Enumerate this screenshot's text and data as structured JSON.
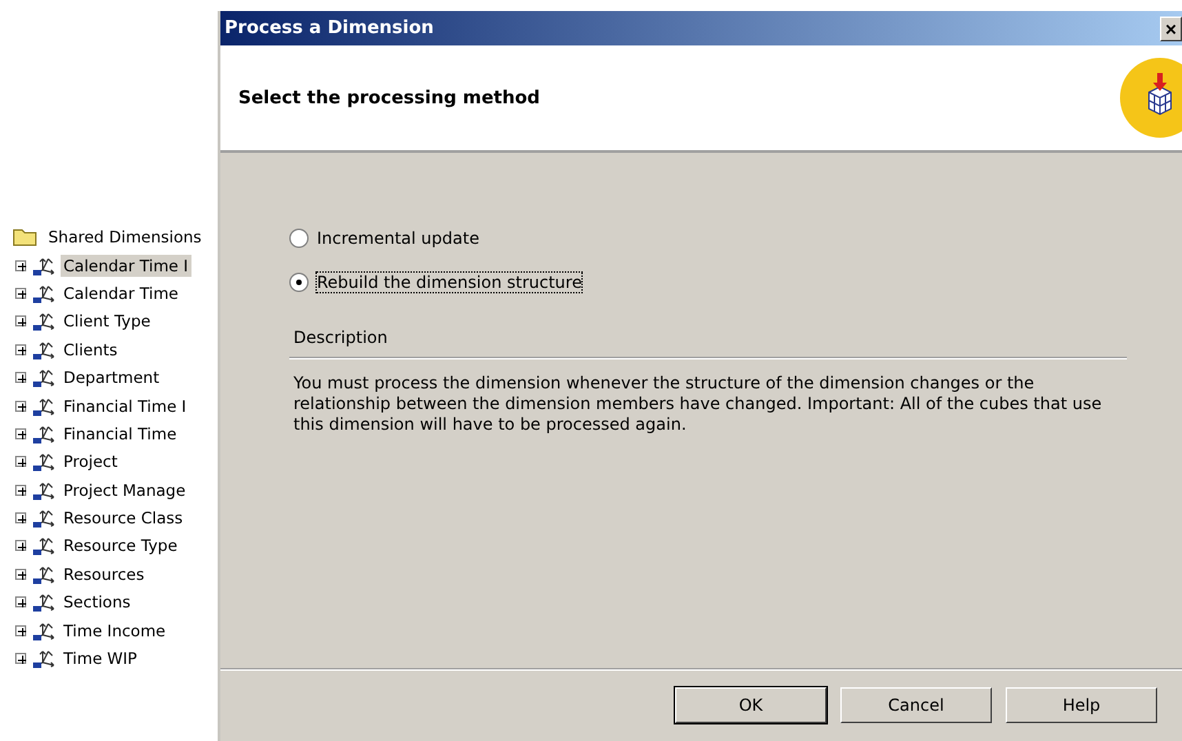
{
  "tree": {
    "label": "Shared Dimensions",
    "children": [
      {
        "label": "Calendar Time I",
        "selected": true,
        "expanded": false
      },
      {
        "label": "Calendar Time",
        "selected": false,
        "expanded": false
      },
      {
        "label": "Client Type",
        "selected": false,
        "expanded": false
      },
      {
        "label": "Clients",
        "selected": false,
        "expanded": false
      },
      {
        "label": "Department",
        "selected": false,
        "expanded": false
      },
      {
        "label": "Financial Time I",
        "selected": false,
        "expanded": false
      },
      {
        "label": "Financial Time",
        "selected": false,
        "expanded": false
      },
      {
        "label": "Project",
        "selected": false,
        "expanded": false
      },
      {
        "label": "Project Manage",
        "selected": false,
        "expanded": false
      },
      {
        "label": "Resource Class",
        "selected": false,
        "expanded": false
      },
      {
        "label": "Resource Type",
        "selected": false,
        "expanded": false
      },
      {
        "label": "Resources",
        "selected": false,
        "expanded": false
      },
      {
        "label": "Sections",
        "selected": false,
        "expanded": false
      },
      {
        "label": "Time Income",
        "selected": false,
        "expanded": false
      },
      {
        "label": "Time WIP",
        "selected": false,
        "expanded": false
      }
    ]
  },
  "dialog": {
    "title": "Process a Dimension",
    "close": "×",
    "header": "Select the processing method",
    "options": [
      {
        "label": "Incremental update",
        "selected": false
      },
      {
        "label": "Rebuild the dimension structure",
        "selected": true
      }
    ],
    "description_label": "Description",
    "description": "You must process the dimension whenever the structure of the dimension changes or the relationship between the dimension members have changed. Important: All of the cubes that use this dimension will have to be processed again.",
    "buttons": [
      {
        "label": "OK",
        "default": true
      },
      {
        "label": "Cancel",
        "default": false
      },
      {
        "label": "Help",
        "default": false
      }
    ]
  }
}
